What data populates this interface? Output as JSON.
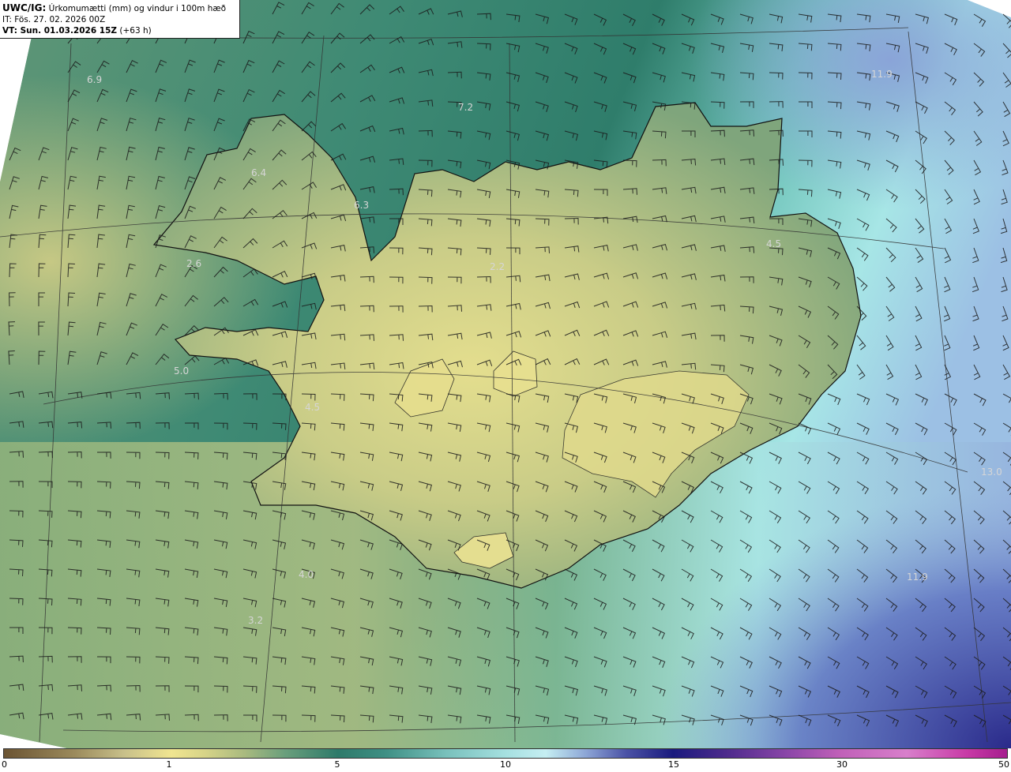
{
  "header": {
    "line1_bold": "UWC/IG:",
    "line1_text": " Úrkomumætti (mm) og vindur i 100m hæð",
    "line2": "IT: Fös. 27. 02. 2026 00Z",
    "line3_bold": "VT: Sun. 01.03.2026 15Z",
    "line3_text": " (+63 h)"
  },
  "colorbar": {
    "ticks": [
      "0",
      "1",
      "5",
      "10",
      "15",
      "30",
      "50"
    ]
  },
  "map_labels": {
    "l01": "6.9",
    "l02": "7.2",
    "l03": "11.9",
    "l04": "6.4",
    "l05": "6.3",
    "l06": "4.5",
    "l07": "2.6",
    "l08": "2.2",
    "l09": "5.0",
    "l10": "4.5",
    "l11": "4.0",
    "l12": "3.2",
    "l13": "11.9",
    "l14": "13.0"
  },
  "colors": {
    "land_light": "#e2dc8c",
    "land_mid": "#a7b97c",
    "sea_green": "#2f7d6b",
    "sea_cyan": "#9ee3e2",
    "sea_blue": "#8ca7d6",
    "sea_deep": "#3b3f9a",
    "coastline": "#111111",
    "gridline": "#333333",
    "label": "#d8d8d8"
  }
}
